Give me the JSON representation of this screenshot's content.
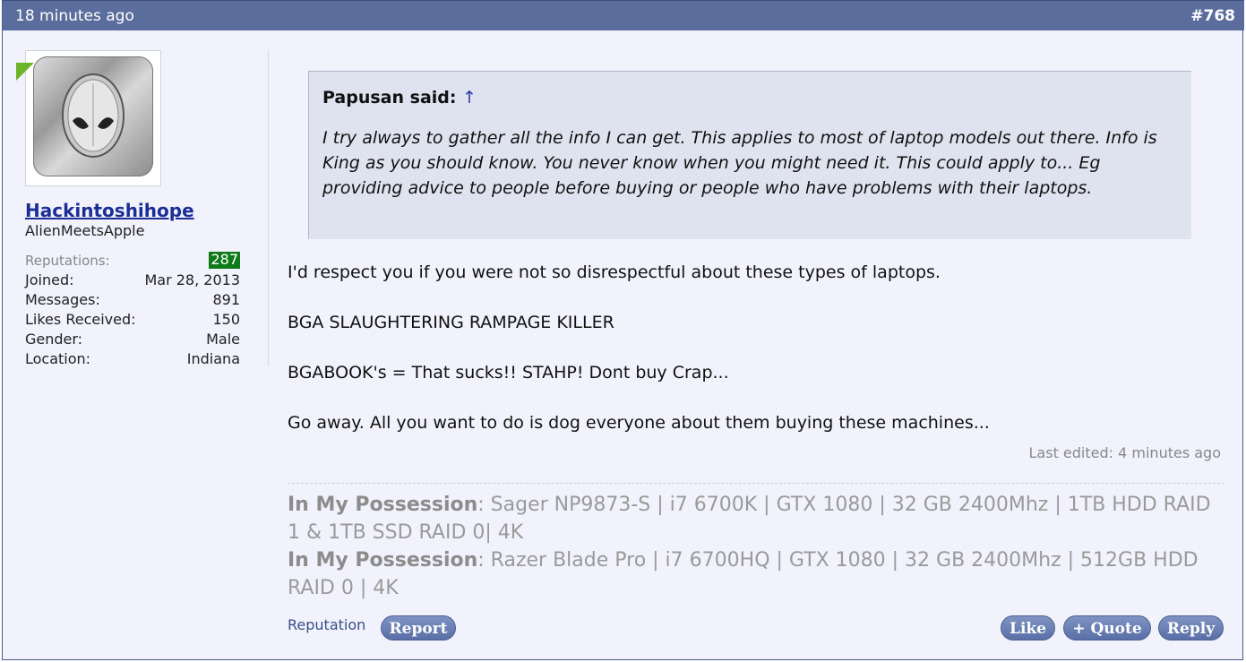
{
  "header": {
    "time": "18 minutes ago",
    "post_number": "#768"
  },
  "user": {
    "name": "Hackintoshihope",
    "title": "AlienMeetsApple",
    "stats": [
      {
        "label": "Reputations:",
        "value": "287"
      },
      {
        "label": "Joined:",
        "value": "Mar 28, 2013"
      },
      {
        "label": "Messages:",
        "value": "891"
      },
      {
        "label": "Likes Received:",
        "value": "150"
      },
      {
        "label": "Gender:",
        "value": "Male"
      },
      {
        "label": "Location:",
        "value": "Indiana"
      }
    ]
  },
  "quote": {
    "author": "Papusan said:",
    "arrow": "↑",
    "text": "I try always to gather all the info I can get. This applies to most of laptop models out there. Info is King as you should know. You never know when you might need it. This could apply to... Eg providing advice to people before buying or people who have problems with their laptops."
  },
  "message": {
    "lines": [
      "I'd respect you if you were not so disrespectful about these types of laptops.",
      "BGA SLAUGHTERING RAMPAGE KILLER",
      "BGABOOK's = That sucks!! STAHP! Dont buy Crap...",
      "Go away. All you want to do is dog everyone about them buying these machines..."
    ],
    "last_edited": "Last edited: 4 minutes ago"
  },
  "signature": [
    {
      "label": "In My Possession",
      "text": ": Sager NP9873-S | i7 6700K | GTX 1080 | 32 GB 2400Mhz | 1TB HDD RAID 1 & 1TB SSD RAID 0| 4K"
    },
    {
      "label": "In My Possession",
      "text": ": Razer Blade Pro | i7 6700HQ | GTX 1080 | 32 GB 2400Mhz | 512GB HDD RAID 0 | 4K"
    }
  ],
  "footer": {
    "reputation_link": "Reputation",
    "report": "Report",
    "like": "Like",
    "quote": "+ Quote",
    "reply": "Reply"
  }
}
